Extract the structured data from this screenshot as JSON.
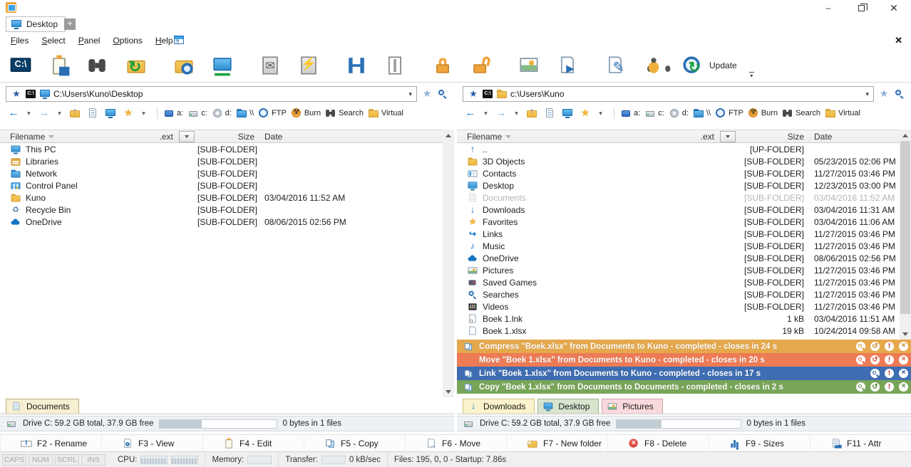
{
  "colors": {
    "accent_blue": "#2a6fb5",
    "notification_orange": "#e5a84c",
    "notification_red": "#ed7b55",
    "notification_blue": "#3e6db2",
    "notification_green": "#78a558"
  },
  "window": {
    "tab_label": "Desktop",
    "new_tab_label": "+",
    "minimize_glyph": "–",
    "close_glyph": "✕"
  },
  "menu": {
    "items": [
      {
        "label": "Files"
      },
      {
        "label": "Select"
      },
      {
        "label": "Panel"
      },
      {
        "label": "Options"
      },
      {
        "label": "Help"
      }
    ],
    "close_glyph": "✕"
  },
  "toolbar": {
    "items": [
      {
        "icon": "cmd-prompt",
        "label": ""
      },
      {
        "icon": "clipboard-info",
        "label": ""
      },
      {
        "icon": "binoculars",
        "label": ""
      },
      {
        "icon": "folder-sync",
        "label": ""
      },
      {
        "type": "sep"
      },
      {
        "icon": "folder-globe",
        "label": ""
      },
      {
        "icon": "network-computer",
        "label": ""
      },
      {
        "type": "sep"
      },
      {
        "icon": "pack-zip",
        "label": ""
      },
      {
        "icon": "unpack-zip",
        "label": ""
      },
      {
        "type": "sep"
      },
      {
        "icon": "split-horizontal",
        "label": ""
      },
      {
        "icon": "split-vertical",
        "label": ""
      },
      {
        "type": "sep"
      },
      {
        "icon": "lock",
        "label": ""
      },
      {
        "icon": "unlock",
        "label": ""
      },
      {
        "type": "sep"
      },
      {
        "icon": "image-viewer",
        "label": ""
      },
      {
        "icon": "run-file",
        "label": ""
      },
      {
        "type": "sep"
      },
      {
        "icon": "edit-file",
        "label": ""
      },
      {
        "icon": "debug-bug",
        "label": ""
      },
      {
        "icon": "globe-update",
        "label": "Update"
      }
    ]
  },
  "drivebar": {
    "items": [
      {
        "icon": "nav-back"
      },
      {
        "icon": "caret"
      },
      {
        "icon": "nav-forward"
      },
      {
        "icon": "caret"
      },
      {
        "icon": "folder-up"
      },
      {
        "icon": "doc-list"
      },
      {
        "icon": "desktop-mini"
      },
      {
        "icon": "fav-star"
      },
      {
        "icon": "caret"
      },
      {
        "type": "sep"
      },
      {
        "icon": "drive-floppy",
        "label": "a:"
      },
      {
        "icon": "drive-hdd",
        "label": "c:"
      },
      {
        "icon": "drive-cd",
        "label": "d:"
      },
      {
        "icon": "net-share",
        "label": "\\\\"
      },
      {
        "icon": "ftp-globe",
        "label": "FTP"
      },
      {
        "icon": "burn-disc",
        "label": "Burn"
      },
      {
        "icon": "search-binoculars",
        "label": "Search"
      },
      {
        "icon": "virtual-folder",
        "label": "Virtual"
      }
    ]
  },
  "columns": {
    "filename": "Filename",
    "ext": ".ext",
    "size": "Size",
    "date": "Date"
  },
  "panels": {
    "left": {
      "path": "C:\\Users\\Kuno\\Desktop",
      "rows": [
        {
          "icon": "this-pc",
          "name": "This PC",
          "size": "[SUB-FOLDER]",
          "date": ""
        },
        {
          "icon": "libraries",
          "name": "Libraries",
          "size": "[SUB-FOLDER]",
          "date": ""
        },
        {
          "icon": "network",
          "name": "Network",
          "size": "[SUB-FOLDER]",
          "date": ""
        },
        {
          "icon": "control-panel",
          "name": "Control Panel",
          "size": "[SUB-FOLDER]",
          "date": ""
        },
        {
          "icon": "folder",
          "name": "Kuno",
          "size": "[SUB-FOLDER]",
          "date": "03/04/2016 11:52 AM"
        },
        {
          "icon": "recycle-bin",
          "name": "Recycle Bin",
          "size": "[SUB-FOLDER]",
          "date": ""
        },
        {
          "icon": "onedrive",
          "name": "OneDrive",
          "size": "[SUB-FOLDER]",
          "date": "08/06/2015 02:56 PM"
        }
      ],
      "tabs": [
        {
          "icon": "documents",
          "label": "Documents",
          "color": "tab-beige"
        }
      ],
      "status": {
        "drive": "Drive C: 59.2 GB total, 37.9 GB free",
        "files": "0 bytes in 1 files"
      }
    },
    "right": {
      "path": "c:\\Users\\Kuno",
      "rows": [
        {
          "icon": "up-dir",
          "name": "..",
          "size": "[UP-FOLDER]",
          "date": ""
        },
        {
          "icon": "folder",
          "name": "3D Objects",
          "size": "[SUB-FOLDER]",
          "date": "05/23/2015 02:06 PM"
        },
        {
          "icon": "contacts",
          "name": "Contacts",
          "size": "[SUB-FOLDER]",
          "date": "11/27/2015 03:46 PM"
        },
        {
          "icon": "desktop",
          "name": "Desktop",
          "size": "[SUB-FOLDER]",
          "date": "12/23/2015 03:00 PM"
        },
        {
          "icon": "documents",
          "name": "Documents",
          "size": "[SUB-FOLDER]",
          "date": "03/04/2016 11:52 AM",
          "state": "dimmed"
        },
        {
          "icon": "downloads",
          "name": "Downloads",
          "size": "[SUB-FOLDER]",
          "date": "03/04/2016 11:31 AM"
        },
        {
          "icon": "favorites",
          "name": "Favorites",
          "size": "[SUB-FOLDER]",
          "date": "03/04/2016 11:06 AM"
        },
        {
          "icon": "links",
          "name": "Links",
          "size": "[SUB-FOLDER]",
          "date": "11/27/2015 03:46 PM"
        },
        {
          "icon": "music",
          "name": "Music",
          "size": "[SUB-FOLDER]",
          "date": "11/27/2015 03:46 PM"
        },
        {
          "icon": "onedrive",
          "name": "OneDrive",
          "size": "[SUB-FOLDER]",
          "date": "08/06/2015 02:56 PM"
        },
        {
          "icon": "pictures",
          "name": "Pictures",
          "size": "[SUB-FOLDER]",
          "date": "11/27/2015 03:46 PM"
        },
        {
          "icon": "saved-games",
          "name": "Saved Games",
          "size": "[SUB-FOLDER]",
          "date": "11/27/2015 03:46 PM"
        },
        {
          "icon": "searches",
          "name": "Searches",
          "size": "[SUB-FOLDER]",
          "date": "11/27/2015 03:46 PM"
        },
        {
          "icon": "videos",
          "name": "Videos",
          "size": "[SUB-FOLDER]",
          "date": "11/27/2015 03:46 PM"
        },
        {
          "icon": "link-file",
          "name": "Boek 1.lnk",
          "size": "1 kB",
          "date": "03/04/2016 11:51 AM"
        },
        {
          "icon": "file",
          "name": "Boek 1.xlsx",
          "size": "19 kB",
          "date": "10/24/2014 09:58 AM"
        }
      ],
      "tabs": [
        {
          "icon": "downloads",
          "label": "Downloads",
          "color": "tab-yellow"
        },
        {
          "icon": "desktop",
          "label": "Desktop",
          "color": "tab-green"
        },
        {
          "icon": "pictures",
          "label": "Pictures",
          "color": "tab-pink"
        }
      ],
      "status": {
        "drive": "Drive C: 59.2 GB total, 37.9 GB free",
        "files": "0 bytes in 1 files"
      }
    }
  },
  "notifications": [
    {
      "color": "notif-orange",
      "left_icon": "copy-pages",
      "text": "Compress \"Boek.xlsx\" from Documents to Kuno - completed - closes in 24 s",
      "undo": ""
    },
    {
      "color": "notif-red",
      "left_icon": "blank",
      "text": "Move \"Boek 1.xlsx\" from Documents to Kuno - completed - closes in 20 s",
      "undo": ""
    },
    {
      "color": "notif-blue",
      "left_icon": "copy-pages",
      "text": "Link \"Boek 1.xlsx\" from Documents to Kuno - completed - closes in 17 s",
      "undo": "undo-hidden"
    },
    {
      "color": "notif-green",
      "left_icon": "copy-pages",
      "text": "Copy \"Boek 1.xlsx\" from Documents to Documents - completed - closes in 2 s",
      "undo": ""
    }
  ],
  "fkeys": [
    {
      "icon": "fk-rename",
      "label": "F2 - Rename"
    },
    {
      "icon": "fk-view",
      "label": "F3 - View"
    },
    {
      "icon": "fk-edit",
      "label": "F4 - Edit"
    },
    {
      "icon": "fk-copy",
      "label": "F5 - Copy"
    },
    {
      "icon": "fk-move",
      "label": "F6 - Move"
    },
    {
      "icon": "new-folder",
      "label": "F7 - New folder"
    },
    {
      "icon": "fk-delete",
      "label": "F8 - Delete"
    },
    {
      "icon": "fk-sizes",
      "label": "F9 - Sizes"
    },
    {
      "icon": "fk-attr",
      "label": "F11 - Attr"
    }
  ],
  "statusline": {
    "locks": [
      "CAPS",
      "NUM",
      "SCRL",
      "INS"
    ],
    "cpu_label": "CPU:",
    "memory_label": "Memory:",
    "transfer_label": "Transfer:",
    "transfer_rate": "0 kB/sec",
    "files_info": "Files: 195, 0, 0 - Startup: 7.86s"
  }
}
